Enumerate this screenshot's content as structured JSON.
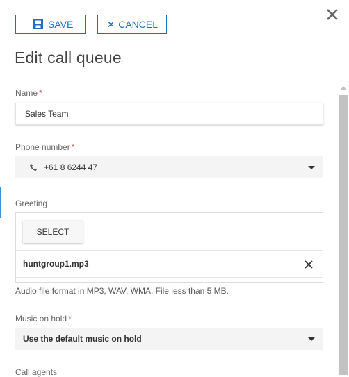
{
  "toolbar": {
    "save_label": "SAVE",
    "cancel_label": "CANCEL"
  },
  "dialog": {
    "title": "Edit call queue"
  },
  "form": {
    "name": {
      "label": "Name",
      "required_mark": "*",
      "value": "Sales Team"
    },
    "phone": {
      "label": "Phone number",
      "required_mark": "*",
      "value": "+61 8 6244 47"
    },
    "greeting": {
      "label": "Greeting",
      "select_label": "SELECT",
      "file_name": "huntgroup1.mp3",
      "hint": "Audio file format in MP3, WAV, WMA. File less than 5 MB."
    },
    "music_on_hold": {
      "label": "Music on hold",
      "required_mark": "*",
      "value": "Use the default music on hold"
    },
    "call_agents": {
      "label": "Call agents"
    }
  },
  "icons": {
    "save": "floppy-disk-icon",
    "cancel": "x-icon",
    "close": "close-icon",
    "phone": "phone-icon",
    "remove": "remove-file-icon",
    "dropdown": "caret-down-icon"
  },
  "colors": {
    "accent": "#1e6fc2",
    "required": "#d9534f",
    "field_bg": "#f4f4f4",
    "scrollbar": "#c2c2c2"
  }
}
